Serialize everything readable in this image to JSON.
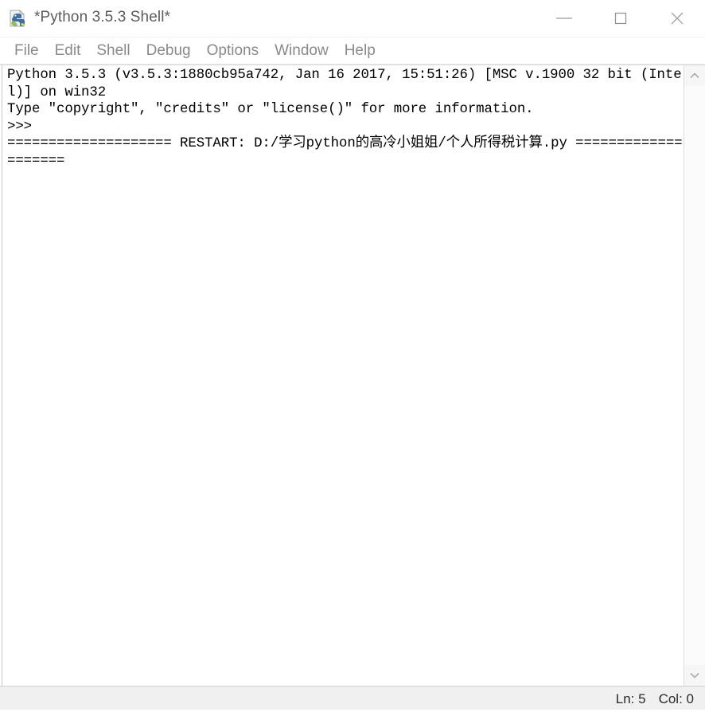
{
  "window": {
    "title": "*Python 3.5.3 Shell*",
    "icon": "python-idle-icon",
    "controls": {
      "minimize": "minimize-icon",
      "maximize": "maximize-icon",
      "close": "close-icon"
    }
  },
  "menubar": {
    "items": [
      {
        "label": "File"
      },
      {
        "label": "Edit"
      },
      {
        "label": "Shell"
      },
      {
        "label": "Debug"
      },
      {
        "label": "Options"
      },
      {
        "label": "Window"
      },
      {
        "label": "Help"
      }
    ]
  },
  "shell": {
    "banner_line_1": "Python 3.5.3 (v3.5.3:1880cb95a742, Jan 16 2017, 15:51:26) [MSC v.1900 32 bit (Intel)] on win32",
    "banner_line_2": "Type \"copyright\", \"credits\" or \"license()\" for more information.",
    "prompt": ">>>",
    "restart_line": "==================== RESTART: D:/学习python的高冷小姐姐/个人所得税计算.py ====================",
    "restart_label": "RESTART:",
    "restart_path": "D:/学习python的高冷小姐姐/个人所得税计算.py",
    "prompt_color": "#a03c28",
    "text_color": "#000000",
    "background": "#ffffff"
  },
  "scrollbar": {
    "up_arrow": "chevron-up-icon",
    "down_arrow": "chevron-down-icon"
  },
  "statusbar": {
    "line_label": "Ln: 5",
    "col_label": "Col: 0"
  }
}
